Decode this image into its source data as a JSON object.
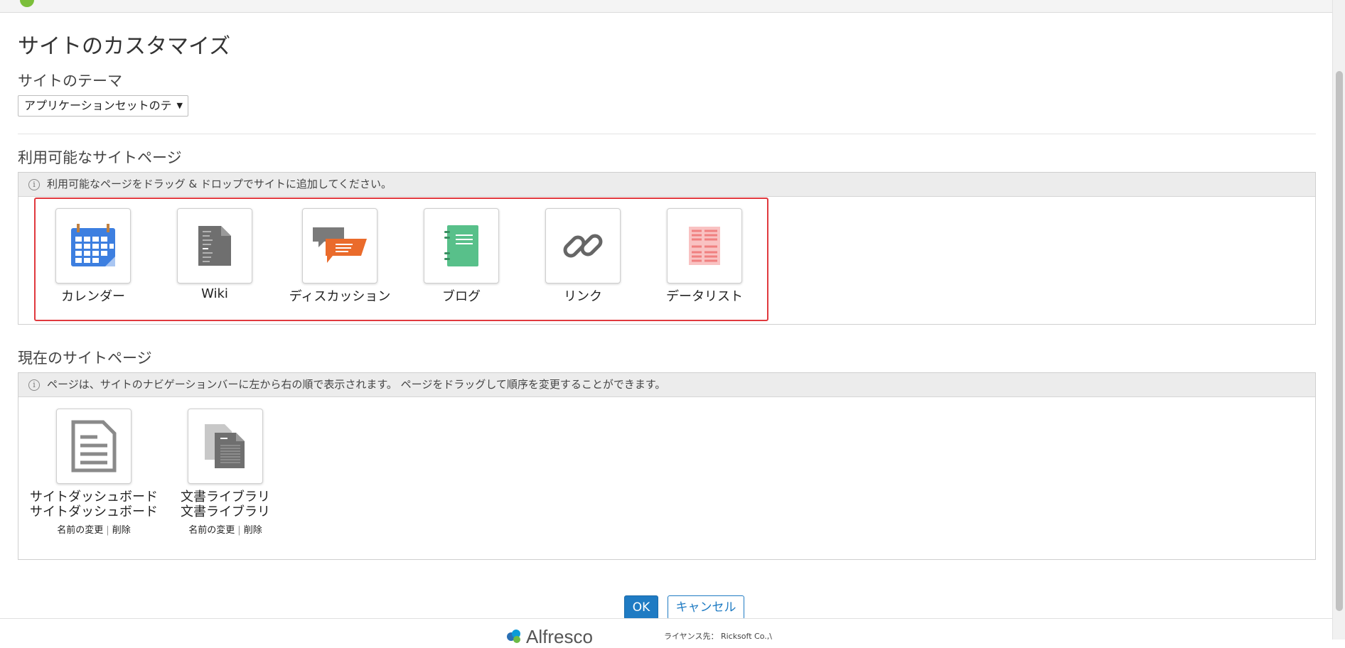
{
  "page": {
    "title": "サイトのカスタマイズ"
  },
  "theme": {
    "section_label": "サイトのテーマ",
    "selected": "アプリケーションセットのテ"
  },
  "available": {
    "section_label": "利用可能なサイトページ",
    "hint": "利用可能なページをドラッグ & ドロップでサイトに追加してください。",
    "items": [
      {
        "label": "カレンダー",
        "icon": "calendar-icon"
      },
      {
        "label": "Wiki",
        "icon": "wiki-icon"
      },
      {
        "label": "ディスカッション",
        "icon": "discussion-icon"
      },
      {
        "label": "ブログ",
        "icon": "blog-icon"
      },
      {
        "label": "リンク",
        "icon": "link-icon"
      },
      {
        "label": "データリスト",
        "icon": "datalist-icon"
      }
    ]
  },
  "current": {
    "section_label": "現在のサイトページ",
    "hint": "ページは、サイトのナビゲーションバーに左から右の順で表示されます。 ページをドラッグして順序を変更することができます。",
    "items": [
      {
        "label": "サイトダッシュボード",
        "sublabel": "サイトダッシュボード",
        "rename": "名前の変更",
        "delete": "削除",
        "icon": "dashboard-icon"
      },
      {
        "label": "文書ライブラリ",
        "sublabel": "文書ライブラリ",
        "rename": "名前の変更",
        "delete": "削除",
        "icon": "document-library-icon"
      }
    ]
  },
  "buttons": {
    "ok": "OK",
    "cancel": "キャンセル"
  },
  "footer": {
    "logo_text": "Alfresco",
    "license": "ライヤンス先： Ricksoft Co.,\\"
  },
  "colors": {
    "primary": "#1f7bc3",
    "highlight": "#e0393e",
    "calendar": "#3d7fe0",
    "discussion": "#ea6b2b",
    "blog": "#58c08a",
    "datalist": "#f08080"
  }
}
